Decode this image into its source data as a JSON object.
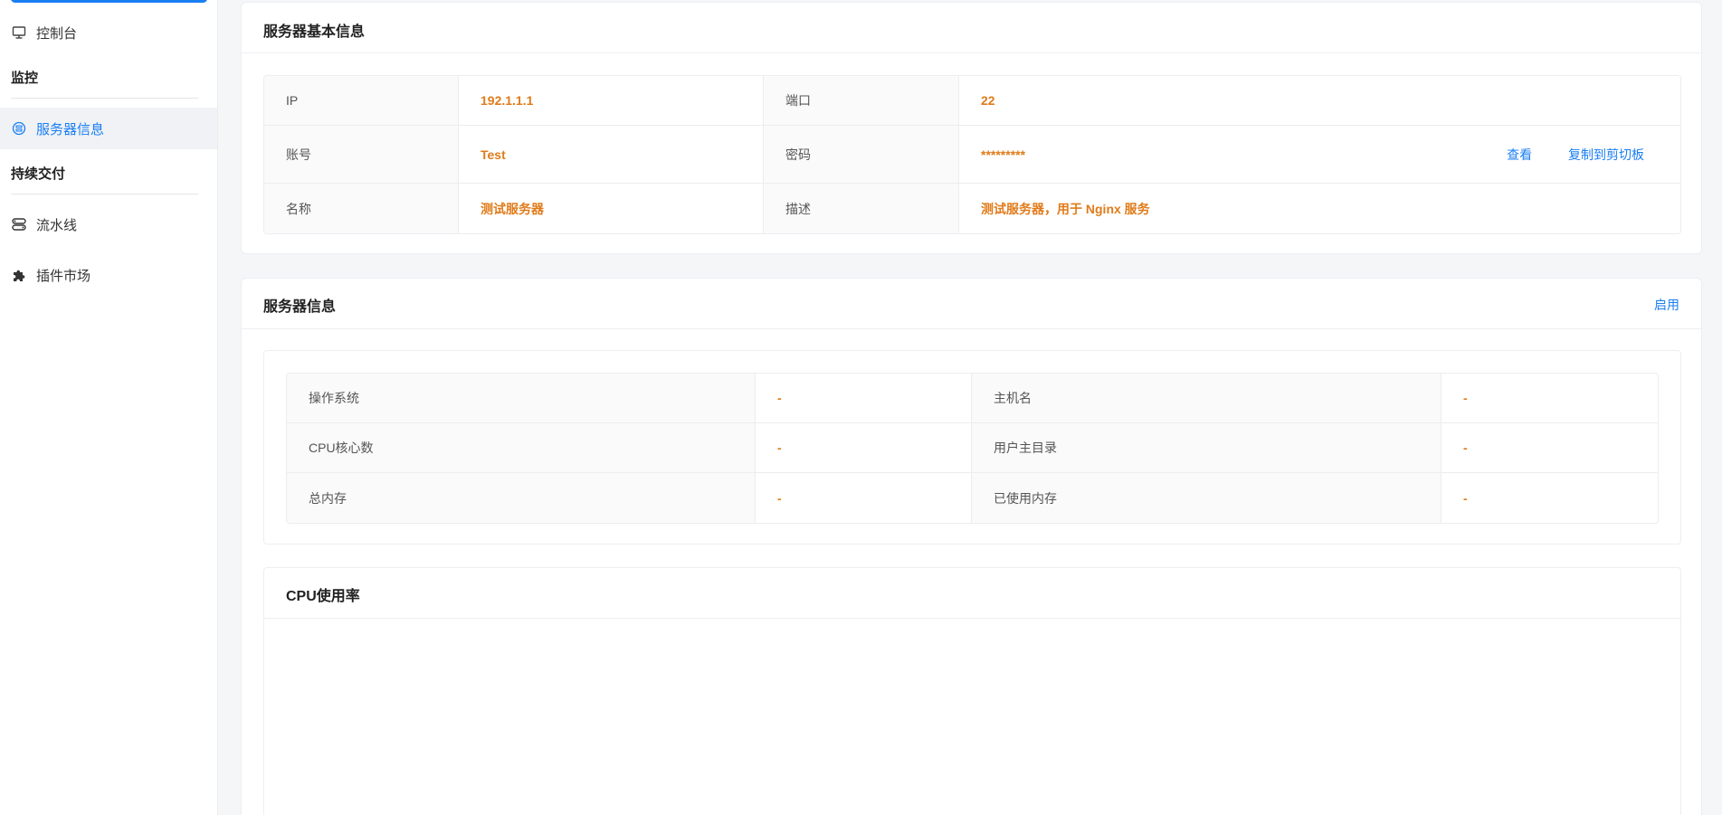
{
  "sidebar": {
    "items": [
      {
        "label": "控制台",
        "icon": "monitor-icon"
      },
      {
        "label": "服务器信息",
        "icon": "server-icon"
      },
      {
        "label": "流水线",
        "icon": "pipeline-icon"
      },
      {
        "label": "插件市场",
        "icon": "puzzle-icon"
      }
    ],
    "groups": [
      "监控",
      "持续交付"
    ]
  },
  "basic": {
    "title": "服务器基本信息",
    "rows": [
      {
        "k1": "IP",
        "v1": "192.1.1.1",
        "k2": "端口",
        "v2": "22"
      },
      {
        "k1": "账号",
        "v1": "Test",
        "k2": "密码",
        "v2": "*********",
        "view": "查看",
        "copy": "复制到剪切板"
      },
      {
        "k1": "名称",
        "v1": "测试服务器",
        "k2": "描述",
        "v2": "测试服务器，用于 Nginx 服务"
      }
    ]
  },
  "info": {
    "title": "服务器信息",
    "enable": "启用",
    "rows": [
      {
        "k1": "操作系统",
        "v1": "-",
        "k2": "主机名",
        "v2": "-"
      },
      {
        "k1": "CPU核心数",
        "v1": "-",
        "k2": "用户主目录",
        "v2": "-"
      },
      {
        "k1": "总内存",
        "v1": "-",
        "k2": "已使用内存",
        "v2": "-"
      }
    ]
  },
  "cpu": {
    "title": "CPU使用率"
  },
  "colors": {
    "accent": "#1a7ef2",
    "value": "#e07b1a"
  }
}
